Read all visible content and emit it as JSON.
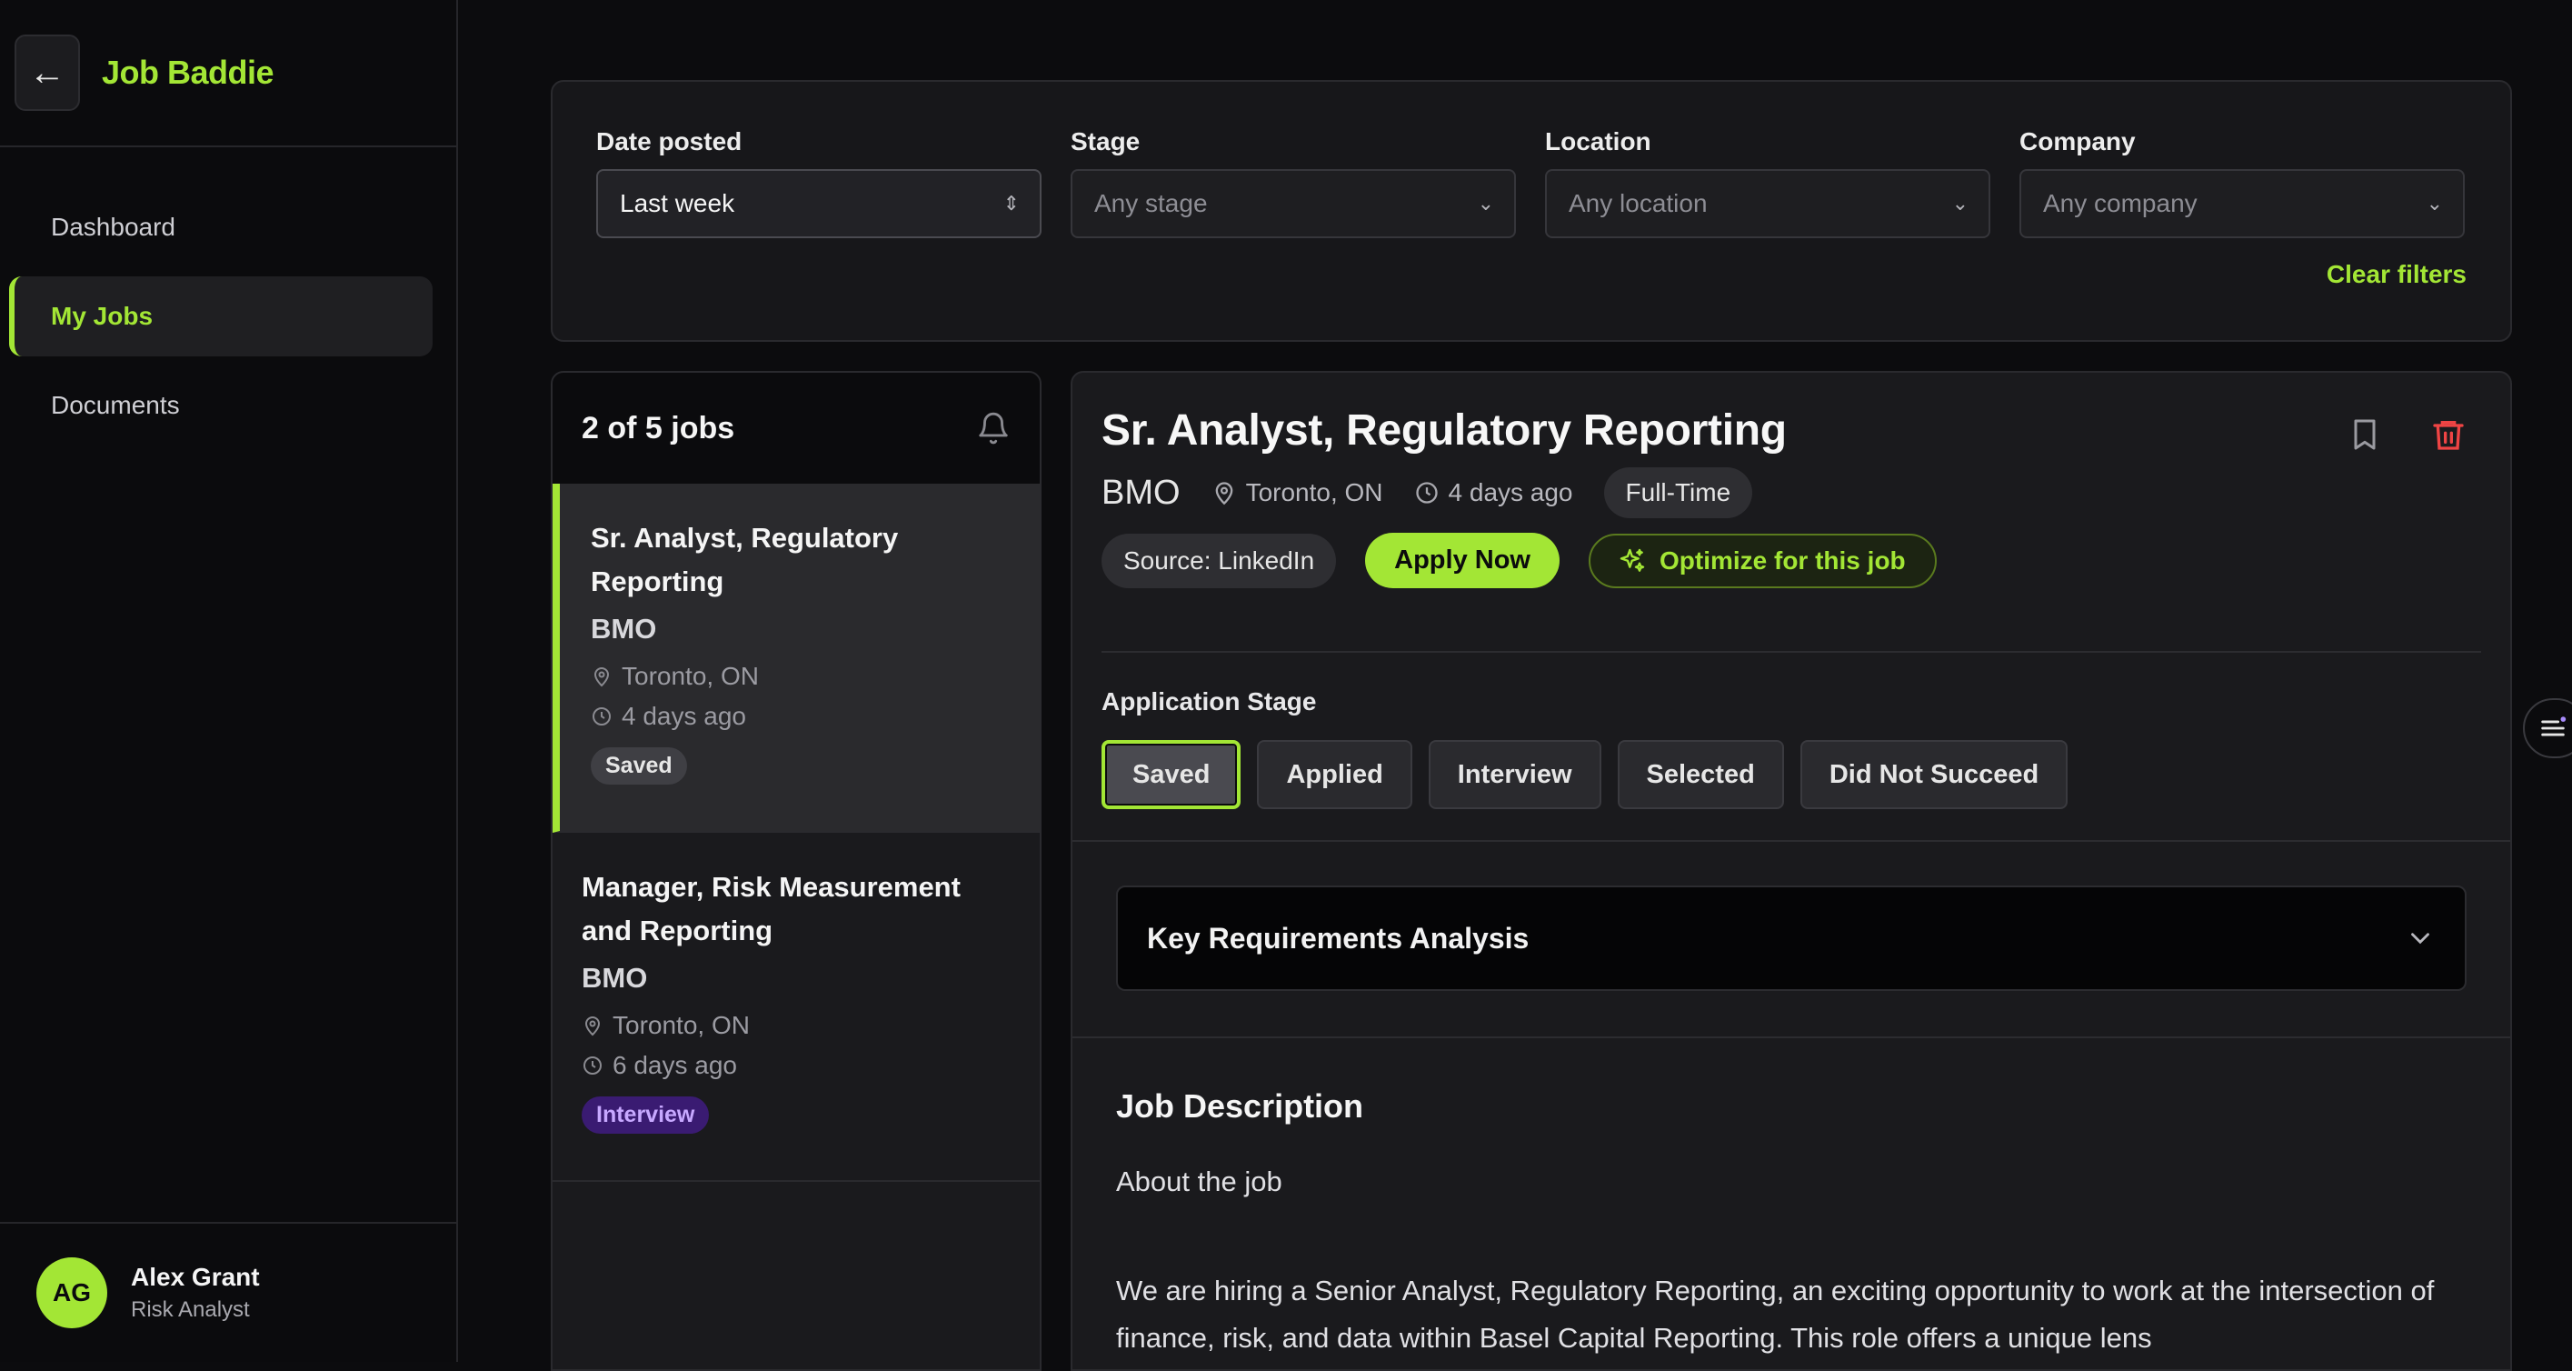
{
  "sidebar": {
    "back_icon": "arrow-left-icon",
    "brand": "Job Baddie",
    "nav": [
      {
        "label": "Dashboard"
      },
      {
        "label": "My Jobs"
      },
      {
        "label": "Documents"
      }
    ],
    "user": {
      "initials": "AG",
      "name": "Alex Grant",
      "role": "Risk Analyst"
    }
  },
  "filters": {
    "date": {
      "label": "Date posted",
      "value": "Last week"
    },
    "stage": {
      "label": "Stage",
      "placeholder": "Any stage"
    },
    "location": {
      "label": "Location",
      "placeholder": "Any location"
    },
    "company": {
      "label": "Company",
      "placeholder": "Any company"
    },
    "clear": "Clear filters"
  },
  "list": {
    "count": "2 of 5 jobs",
    "jobs": [
      {
        "title": "Sr. Analyst, Regulatory Reporting",
        "company": "BMO",
        "location": "Toronto, ON",
        "posted": "4 days ago",
        "stage": "Saved"
      },
      {
        "title": "Manager, Risk Measurement and Reporting",
        "company": "BMO",
        "location": "Toronto, ON",
        "posted": "6 days ago",
        "stage": "Interview"
      }
    ]
  },
  "detail": {
    "title": "Sr. Analyst, Regulatory Reporting",
    "company": "BMO",
    "location": "Toronto, ON",
    "posted": "4 days ago",
    "type": "Full-Time",
    "source": "Source: LinkedIn",
    "apply": "Apply Now",
    "optimize": "Optimize for this job",
    "stage_label": "Application Stage",
    "stages": [
      "Saved",
      "Applied",
      "Interview",
      "Selected",
      "Did Not Succeed"
    ],
    "active_stage": "Saved",
    "kra": "Key Requirements Analysis",
    "jd_title": "Job Description",
    "jd_sub": "About the job",
    "jd_body": "We are hiring a Senior Analyst, Regulatory Reporting, an exciting opportunity to work at the intersection of finance, risk, and data within Basel Capital Reporting. This role offers a unique lens"
  },
  "colors": {
    "accent": "#a3e635",
    "delete": "#ef4444",
    "interview": "#3a1b72"
  }
}
